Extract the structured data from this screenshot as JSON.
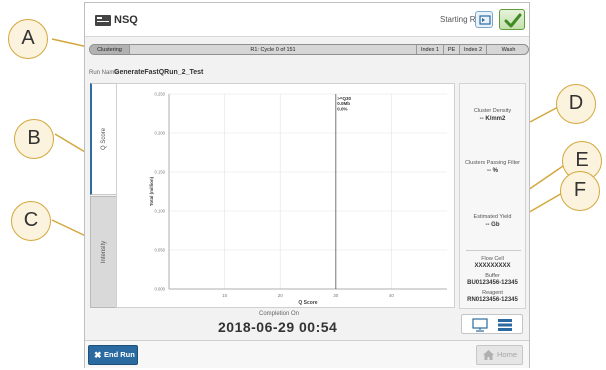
{
  "app": {
    "brand": "NSQ",
    "run_status": "Starting Run"
  },
  "steps": [
    {
      "label": "Clustering",
      "active": true
    },
    {
      "label": "R1: Cycle 0 of 151",
      "active": false
    },
    {
      "label": "Index 1",
      "active": false
    },
    {
      "label": "PE",
      "active": false
    },
    {
      "label": "Index 2",
      "active": false
    },
    {
      "label": "Wash",
      "active": false
    }
  ],
  "run": {
    "label": "Run Name:",
    "value": "GenerateFastQRun_2_Test"
  },
  "tabs": [
    {
      "label": "Q Score",
      "active": true
    },
    {
      "label": "Intensity",
      "active": false
    }
  ],
  "metrics": {
    "cluster_density": {
      "label": "Cluster Density",
      "value": "-- K/mm2"
    },
    "clusters_passing": {
      "label": "Clusters Passing Filter",
      "value": "-- %"
    },
    "estimated_yield": {
      "label": "Estimated Yield",
      "value": "-- Gb"
    },
    "flow_cell": {
      "label": "Flow Cell",
      "value": "XXXXXXXXX"
    },
    "buffer": {
      "label": "Buffer",
      "value": "BU0123456-12345"
    },
    "reagent": {
      "label": "Reagent",
      "value": "RN0123456-12345"
    }
  },
  "completion": {
    "label": "Completion On",
    "value": "2018-06-29   00:54"
  },
  "buttons": {
    "end_run": "End Run",
    "home": "Home"
  },
  "callouts": [
    "A",
    "B",
    "C",
    "D",
    "E",
    "F"
  ],
  "icons": {
    "brand": "instrument-icon",
    "back": "back-icon",
    "confirm": "checkmark-icon",
    "end_run": "close-icon",
    "home": "home-icon",
    "view_chart": "monitor-icon",
    "view_table": "list-icon"
  },
  "colors": {
    "accent_blue": "#2b6aa0",
    "confirm_green": "#5f9c3a",
    "callout_fill": "#fbf3dd",
    "callout_border": "#d4a73c"
  },
  "chart_data": {
    "type": "bar",
    "xlabel": "Q Score",
    "ylabel": "Total (million)",
    "xlim": [
      0,
      50
    ],
    "ylim": [
      0,
      0.25
    ],
    "x_ticks": [
      10,
      20,
      30,
      40
    ],
    "y_ticks": [
      "0.000",
      "0.050",
      "0.100",
      "0.150",
      "0.200",
      "0.250"
    ],
    "y_tick_values": [
      0,
      0.05,
      0.1,
      0.15,
      0.2,
      0.25
    ],
    "threshold": {
      "x": 30,
      "lines": [
        ">=Q30",
        "0.0Mb",
        "0.0%"
      ]
    },
    "grid": true,
    "series": []
  }
}
